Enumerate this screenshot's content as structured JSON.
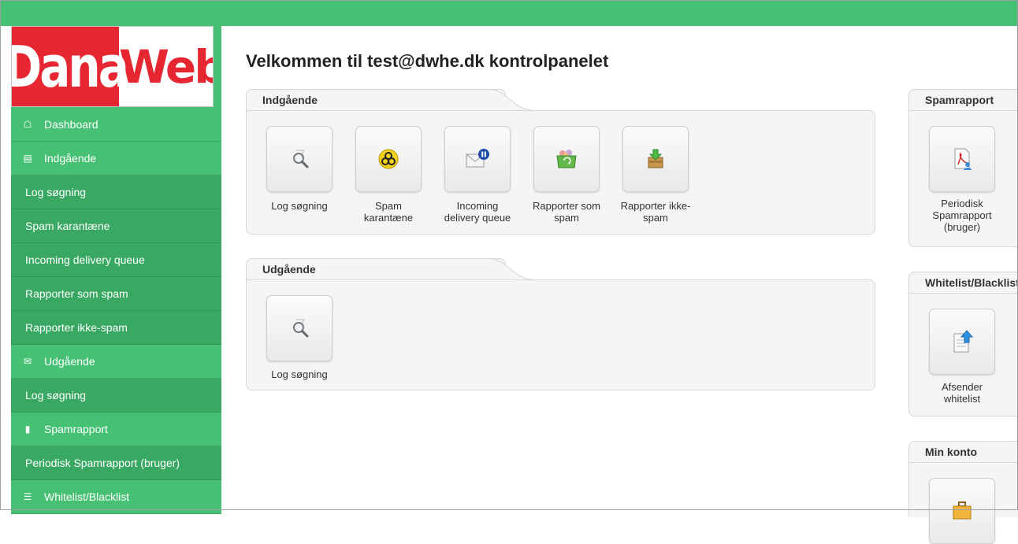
{
  "logo": {
    "left": "Dana",
    "right": "Web"
  },
  "sidebar": {
    "items": [
      {
        "label": "Dashboard",
        "level": "top",
        "icon": "home-icon"
      },
      {
        "label": "Indgående",
        "level": "top",
        "icon": "inbox-icon"
      },
      {
        "label": "Log søgning",
        "level": "sub"
      },
      {
        "label": "Spam karantæne",
        "level": "sub"
      },
      {
        "label": "Incoming delivery queue",
        "level": "sub"
      },
      {
        "label": "Rapporter som spam",
        "level": "sub"
      },
      {
        "label": "Rapporter ikke-spam",
        "level": "sub"
      },
      {
        "label": "Udgående",
        "level": "top",
        "icon": "envelope-icon"
      },
      {
        "label": "Log søgning",
        "level": "sub"
      },
      {
        "label": "Spamrapport",
        "level": "top",
        "icon": "file-icon"
      },
      {
        "label": "Periodisk Spamrapport (bruger)",
        "level": "sub"
      },
      {
        "label": "Whitelist/Blacklist",
        "level": "top",
        "icon": "list-icon"
      }
    ]
  },
  "main": {
    "title": "Velkommen til test@dwhe.dk kontrolpanelet",
    "incoming": {
      "heading": "Indgående",
      "buttons": [
        {
          "label1": "Log søgning",
          "label2": "",
          "icon": "magnifier-icon"
        },
        {
          "label1": "Spam",
          "label2": "karantæne",
          "icon": "biohazard-icon"
        },
        {
          "label1": "Incoming",
          "label2": "delivery queue",
          "icon": "mail-pause-icon"
        },
        {
          "label1": "Rapporter som",
          "label2": "spam",
          "icon": "recycle-bin-icon"
        },
        {
          "label1": "Rapporter ikke-",
          "label2": "spam",
          "icon": "inbox-download-icon"
        }
      ]
    },
    "outgoing": {
      "heading": "Udgående",
      "buttons": [
        {
          "label1": "Log søgning",
          "label2": "",
          "icon": "magnifier-icon"
        }
      ]
    },
    "spamreport": {
      "heading": "Spamrapport",
      "button": {
        "label1": "Periodisk",
        "label2": "Spamrapport",
        "label3": "(bruger)",
        "icon": "pdf-user-icon"
      }
    },
    "whitelist": {
      "heading": "Whitelist/Blacklist",
      "button": {
        "label1": "Afsender",
        "label2": "whitelist",
        "icon": "document-upload-icon"
      }
    },
    "account": {
      "heading": "Min konto"
    }
  }
}
